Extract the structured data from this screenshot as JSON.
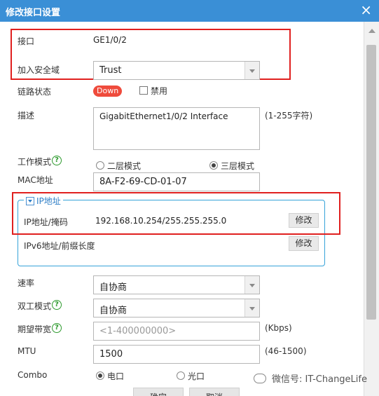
{
  "dialog": {
    "title": "修改接口设置"
  },
  "fields": {
    "interface": {
      "label": "接口",
      "value": "GE1/0/2"
    },
    "security_zone": {
      "label": "加入安全域",
      "value": "Trust"
    },
    "link_status": {
      "label": "链路状态",
      "badge": "Down",
      "disable_label": "禁用"
    },
    "description": {
      "label": "描述",
      "value": "GigabitEthernet1/0/2 Interface",
      "hint": "(1-255字符)"
    },
    "work_mode": {
      "label": "工作模式",
      "options": [
        "二层模式",
        "三层模式"
      ],
      "selected": "三层模式"
    },
    "mac": {
      "label": "MAC地址",
      "value": "8A-F2-69-CD-01-07"
    },
    "ip_section": {
      "legend": "IP地址",
      "ip_mask_label": "IP地址/掩码",
      "ip_mask_value": "192.168.10.254/255.255.255.0",
      "ipv6_label": "IPv6地址/前缀长度",
      "edit_label": "修改"
    },
    "speed": {
      "label": "速率",
      "value": "自协商"
    },
    "duplex": {
      "label": "双工模式",
      "value": "自协商"
    },
    "bandwidth": {
      "label": "期望带宽",
      "placeholder": "<1-400000000>",
      "hint": "(Kbps)"
    },
    "mtu": {
      "label": "MTU",
      "value": "1500",
      "hint": "(46-1500)"
    },
    "combo": {
      "label": "Combo",
      "options": [
        "电口",
        "光口"
      ],
      "selected": "电口"
    }
  },
  "buttons": {
    "ok": "确定",
    "cancel": "取消"
  },
  "watermark": {
    "text": "微信号: IT-ChangeLife"
  },
  "icons": {
    "help": "?",
    "close": "×"
  },
  "colors": {
    "titlebar": "#3a8fd6",
    "highlight": "#e0201f",
    "badge": "#ef4b3c",
    "help": "#2e9a2e"
  }
}
